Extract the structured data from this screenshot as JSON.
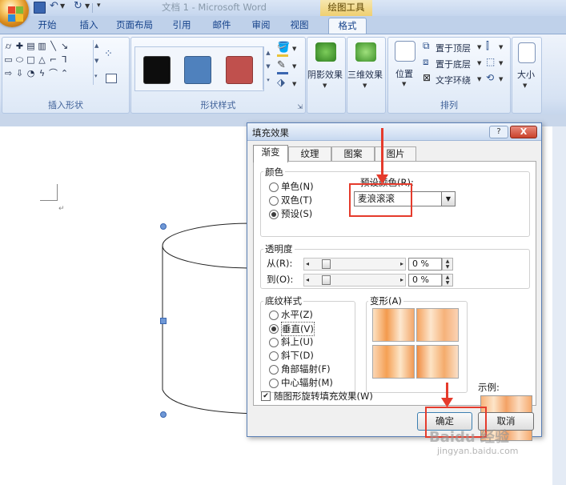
{
  "window": {
    "title": "文档 1 - Microsoft Word",
    "context_tab_group": "绘图工具"
  },
  "ribbon": {
    "tabs": [
      "开始",
      "插入",
      "页面布局",
      "引用",
      "邮件",
      "审阅",
      "视图",
      "格式"
    ],
    "active_tab": "格式",
    "groups": {
      "insert_shapes": "插入形状",
      "shape_styles": "形状样式",
      "shadow_effects": "阴影效果",
      "effects_3d": "三维效果",
      "arrange": "排列",
      "size": "大小"
    },
    "arrange_buttons": {
      "position": "位置",
      "bring_to_front": "置于顶层",
      "send_to_back": "置于底层",
      "text_wrap": "文字环绕"
    },
    "style_swatch_colors": [
      "#0d0d0d",
      "#4f81bd",
      "#c0504d"
    ]
  },
  "dialog": {
    "title": "填充效果",
    "help": "?",
    "close": "X",
    "tabs": [
      "渐变",
      "纹理",
      "图案",
      "图片"
    ],
    "active_tab": "渐变",
    "colors": {
      "legend": "颜色",
      "options": [
        "单色(N)",
        "双色(T)",
        "预设(S)"
      ],
      "selected": "预设(S)",
      "preset_label": "预设颜色(R):",
      "preset_value": "麦浪滚滚"
    },
    "transparency": {
      "legend": "透明度",
      "from_label": "从(R):",
      "to_label": "到(O):",
      "from_value": "0 %",
      "to_value": "0 %",
      "from_percent": 0,
      "to_percent": 0
    },
    "shading": {
      "legend": "底纹样式",
      "options": [
        "水平(Z)",
        "垂直(V)",
        "斜上(U)",
        "斜下(D)",
        "角部辐射(F)",
        "中心辐射(M)"
      ],
      "selected": "垂直(V)",
      "variants_label": "变形(A)"
    },
    "rotate_checkbox": {
      "label": "随图形旋转填充效果(W)",
      "checked": true
    },
    "sample_label": "示例:",
    "ok": "确定",
    "cancel": "取消"
  },
  "watermark": {
    "brand": "Baidu 经验",
    "url": "jingyan.baidu.com"
  }
}
